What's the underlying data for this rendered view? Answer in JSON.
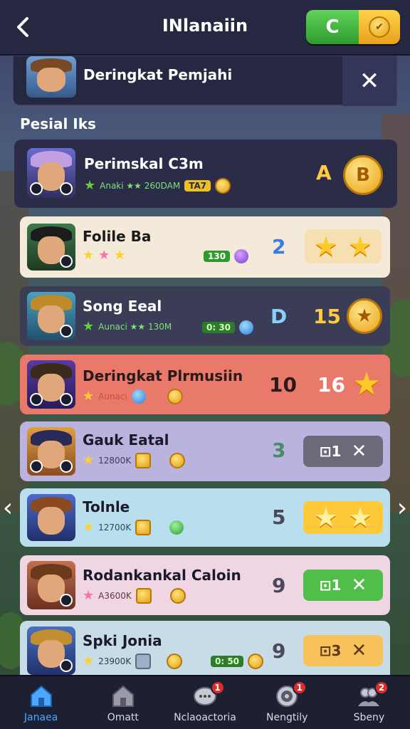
{
  "header": {
    "title": "INlanaiin",
    "currency_label": "C"
  },
  "banner": {
    "text": "Deringkat Pemjahi"
  },
  "section": {
    "label": "Pesial Iks"
  },
  "rows": [
    {
      "name": "Perimskal C3m",
      "meta": "Anaki ★★ 260DAM",
      "tag": "TA7",
      "rank": "A",
      "action": "coin",
      "action_text": "B"
    },
    {
      "name": "Folile Ba",
      "meta_count": "130",
      "rank": "2",
      "action": "stars"
    },
    {
      "name": "Song Eeal",
      "meta": "Aunaci ★★ 130M",
      "meta_count": "0: 30",
      "rank": "D",
      "score": "15",
      "action": "coin-star"
    },
    {
      "name": "Deringkat Plrmusiin",
      "meta": "Aunaci",
      "rank": "10",
      "score": "16",
      "action": "star"
    },
    {
      "name": "Gauk Eatal",
      "meta": "12800K",
      "rank": "3",
      "action_text": "1",
      "action": "gray"
    },
    {
      "name": "Tolnle",
      "meta": "12700K",
      "rank": "5",
      "action": "stars"
    },
    {
      "name": "Rodankankal Caloin",
      "meta": "A3600K",
      "rank": "9",
      "action_text": "1",
      "action": "green"
    },
    {
      "name": "Spki Jonia",
      "meta": "23900K",
      "meta_count": "0: 50",
      "rank": "9",
      "action_text": "3",
      "action": "orange"
    }
  ],
  "nav": [
    {
      "label": "Janaea",
      "icon": "home-icon",
      "badge": "",
      "active": true
    },
    {
      "label": "Omatt",
      "icon": "house-icon",
      "badge": "",
      "active": false
    },
    {
      "label": "Nclaoactoria",
      "icon": "chat-icon",
      "badge": "1",
      "active": false
    },
    {
      "label": "Nengtily",
      "icon": "target-icon",
      "badge": "1",
      "active": false
    },
    {
      "label": "Sbeny",
      "icon": "friends-icon",
      "badge": "2",
      "active": false
    }
  ],
  "colors": {
    "row_dark": "#2b2d48",
    "row_cream": "#f4ead9",
    "row_slate": "#3a3d55",
    "row_salmon": "#e9796a",
    "row_lavender": "#b9b3de",
    "row_sky": "#b9dfef",
    "row_pink": "#efd6e2",
    "row_light": "#c7dce6"
  }
}
